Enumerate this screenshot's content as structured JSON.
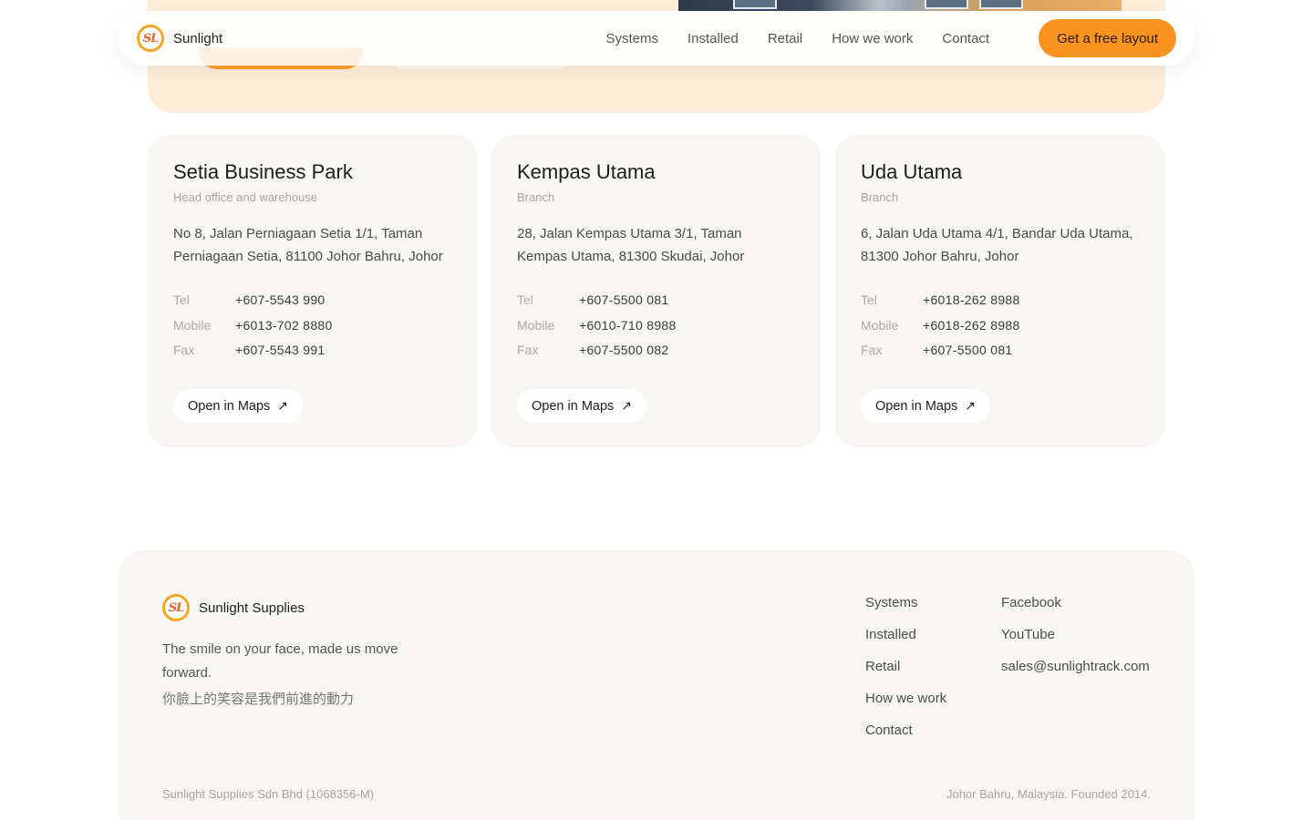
{
  "nav": {
    "brand": "Sunlight",
    "logo_text": "SL",
    "links": [
      "Systems",
      "Installed",
      "Retail",
      "How we work",
      "Contact"
    ],
    "cta": "Get a free layout"
  },
  "branches": [
    {
      "name": "Setia Business Park",
      "type": "Head office and warehouse",
      "address": "No 8, Jalan Perniagaan Setia 1/1, Taman Perniagaan Setia, 81100 Johor Bahru, Johor",
      "contacts": [
        {
          "label": "Tel",
          "value": "+607-5543 990"
        },
        {
          "label": "Mobile",
          "value": "+6013-702 8880"
        },
        {
          "label": "Fax",
          "value": "+607-5543 991"
        }
      ],
      "maps_label": "Open in Maps"
    },
    {
      "name": "Kempas Utama",
      "type": "Branch",
      "address": "28, Jalan Kempas Utama 3/1, Taman Kempas Utama, 81300 Skudai, Johor",
      "contacts": [
        {
          "label": "Tel",
          "value": "+607-5500 081"
        },
        {
          "label": "Mobile",
          "value": "+6010-710 8988"
        },
        {
          "label": "Fax",
          "value": "+607-5500 082"
        }
      ],
      "maps_label": "Open in Maps"
    },
    {
      "name": "Uda Utama",
      "type": "Branch",
      "address": "6, Jalan Uda Utama 4/1, Bandar Uda Utama, 81300 Johor Bahru, Johor",
      "contacts": [
        {
          "label": "Tel",
          "value": "+6018-262 8988"
        },
        {
          "label": "Mobile",
          "value": "+6018-262 8988"
        },
        {
          "label": "Fax",
          "value": "+607-5500 081"
        }
      ],
      "maps_label": "Open in Maps"
    }
  ],
  "footer": {
    "brand": "Sunlight Supplies",
    "logo_text": "SL",
    "tagline": "The smile on your face, made us move forward.",
    "tagline_zh": "你臉上的笑容是我們前進的動力",
    "nav_links": [
      "Systems",
      "Installed",
      "Retail",
      "How we work",
      "Contact"
    ],
    "social_links": [
      "Facebook",
      "YouTube",
      "sales@sunlightrack.com"
    ],
    "legal": "Sunlight Supplies Sdn Bhd (1068356-M)",
    "founded": "Johor Bahru, Malaysia. Founded 2014."
  },
  "colors": {
    "accent": "#f7931e",
    "hero_bg": "#fdecd8",
    "card_bg": "#f8f6f3",
    "logo_ring": "#f6a623"
  },
  "icons": {
    "logo": "sunlight-logo-icon",
    "maps_arrow": "arrow-up-right-icon"
  }
}
